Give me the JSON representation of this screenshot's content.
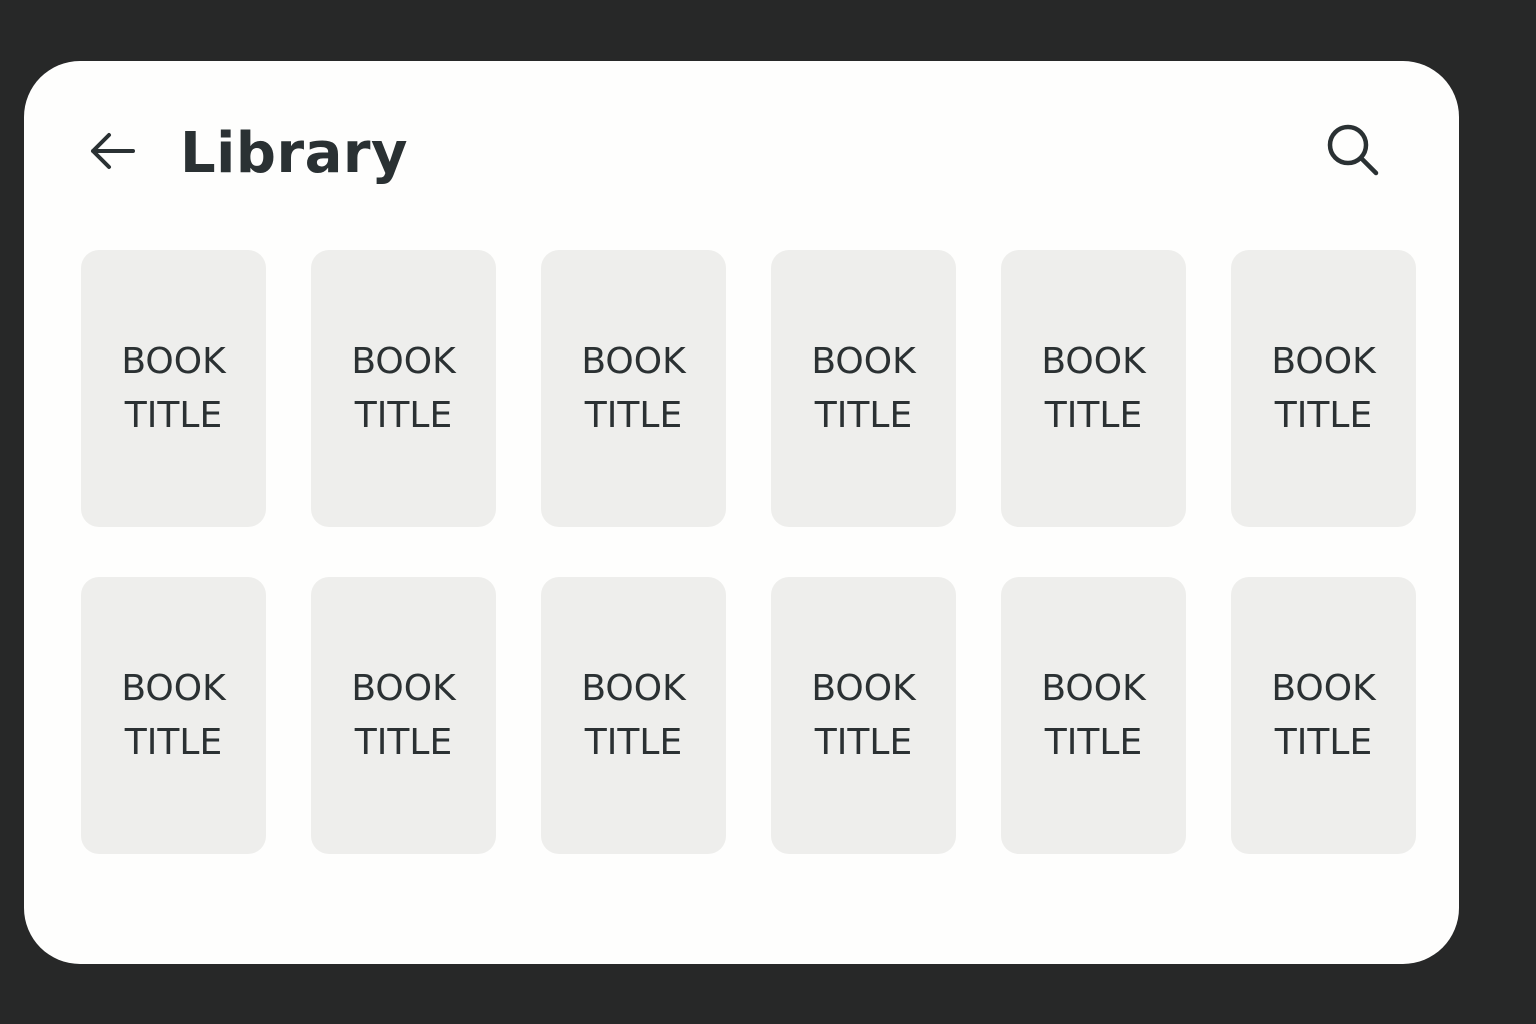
{
  "header": {
    "title": "Library",
    "back_icon": "arrow-left-icon",
    "search_icon": "search-icon"
  },
  "colors": {
    "frame": "#272828",
    "screen": "#fefefd",
    "card": "#eeeeec",
    "text": "#2a3133"
  },
  "books": [
    {
      "title": "BOOK TITLE"
    },
    {
      "title": "BOOK TITLE"
    },
    {
      "title": "BOOK TITLE"
    },
    {
      "title": "BOOK TITLE"
    },
    {
      "title": "BOOK TITLE"
    },
    {
      "title": "BOOK TITLE"
    },
    {
      "title": "BOOK TITLE"
    },
    {
      "title": "BOOK TITLE"
    },
    {
      "title": "BOOK TITLE"
    },
    {
      "title": "BOOK TITLE"
    },
    {
      "title": "BOOK TITLE"
    },
    {
      "title": "BOOK TITLE"
    }
  ]
}
